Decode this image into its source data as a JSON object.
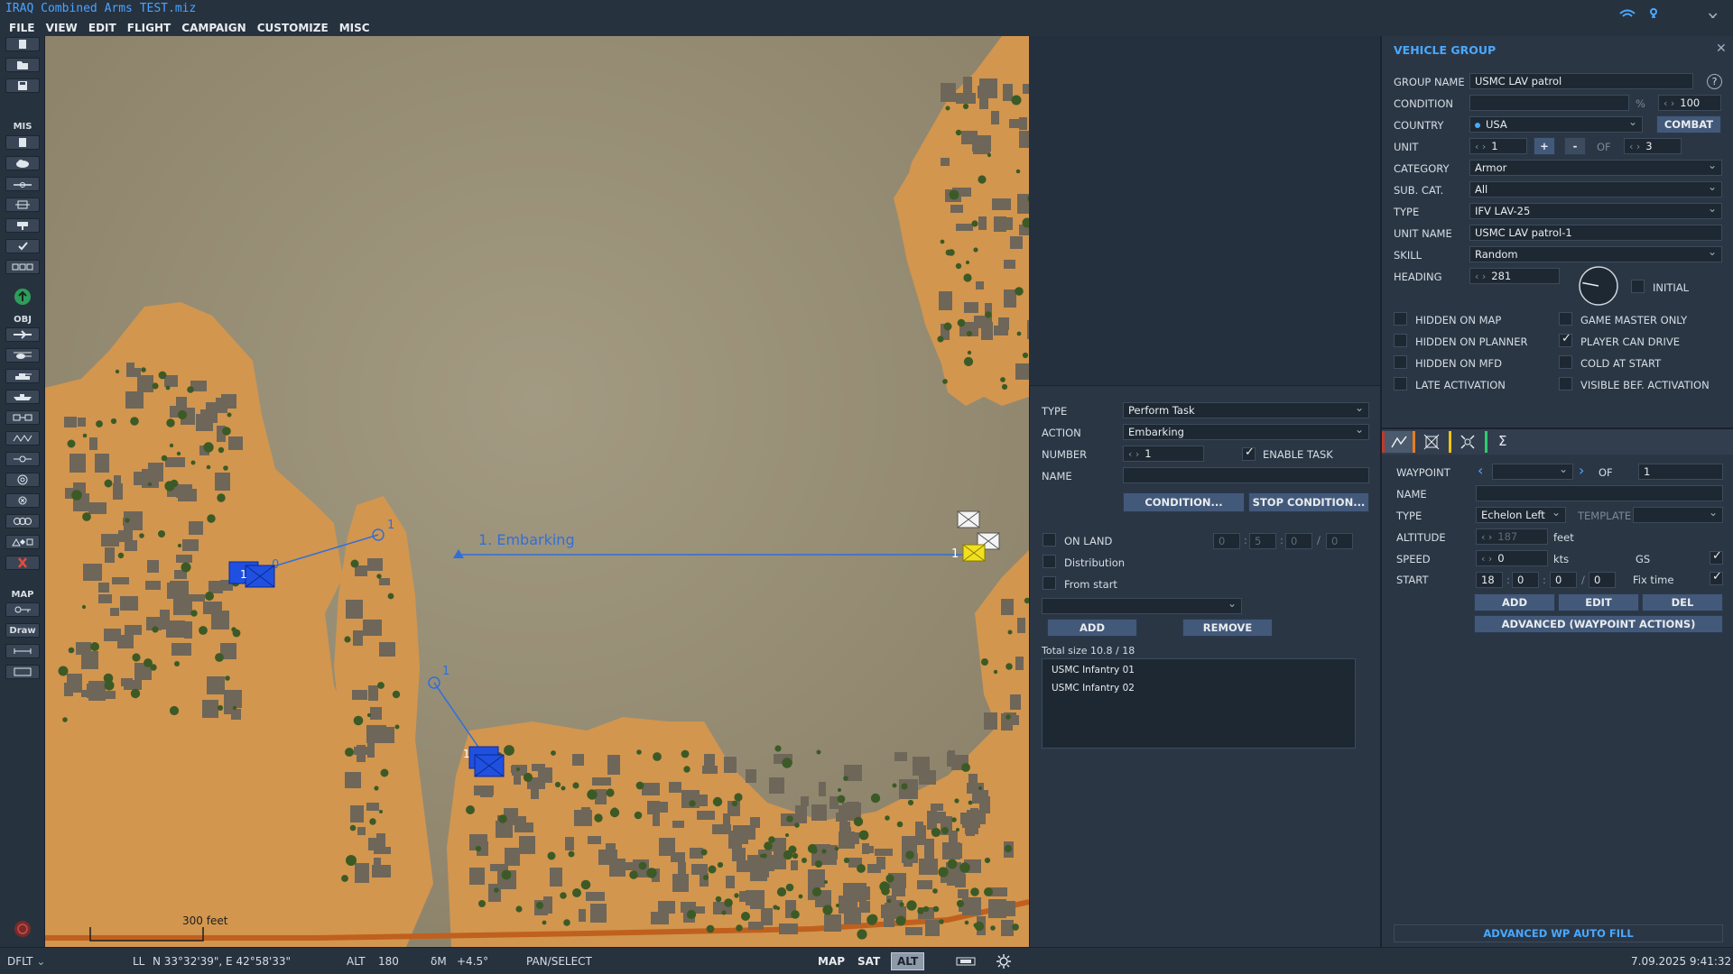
{
  "app": {
    "title": "IRAQ Combined Arms TEST.miz"
  },
  "menu": [
    "FILE",
    "VIEW",
    "EDIT",
    "FLIGHT",
    "CAMPAIGN",
    "CUSTOMIZE",
    "MISC"
  ],
  "left_toolbar": {
    "section_mis": "MIS",
    "section_obj": "OBJ",
    "section_map": "MAP",
    "draw_label": "Draw"
  },
  "map": {
    "route_label": "1. Embarking",
    "group1_num": "1",
    "group1_wp0": "0",
    "group1_wp1": "1",
    "group2_num": "1",
    "group2_wp1": "1",
    "target_num": "1",
    "scale_label": "300 feet"
  },
  "task": {
    "type_label": "TYPE",
    "type_value": "Perform Task",
    "action_label": "ACTION",
    "action_value": "Embarking",
    "number_label": "NUMBER",
    "number_value": "1",
    "enable_task_label": "ENABLE TASK",
    "enable_task_checked": true,
    "name_label": "NAME",
    "name_value": "",
    "condition_btn": "CONDITION...",
    "stop_condition_btn": "STOP CONDITION...",
    "on_land_label": "ON LAND",
    "on_land_time": [
      "0",
      "5",
      "0",
      "0"
    ],
    "distribution_label": "Distribution",
    "from_start_label": "From start",
    "add_btn": "ADD",
    "remove_btn": "REMOVE",
    "total_size": "Total size 10.8 / 18",
    "cargo": [
      "USMC Infantry 01",
      "USMC Infantry 02"
    ]
  },
  "vehicle_group": {
    "title": "VEHICLE GROUP",
    "help": "?",
    "group_name_label": "GROUP NAME",
    "group_name": "USMC LAV patrol",
    "condition_label": "CONDITION",
    "condition_pct": "%",
    "condition_value": "100",
    "country_label": "COUNTRY",
    "country": "USA",
    "combat_btn": "COMBAT",
    "unit_label": "UNIT",
    "unit_value": "1",
    "plus": "+",
    "minus": "-",
    "of_label": "OF",
    "unit_total": "3",
    "category_label": "CATEGORY",
    "category": "Armor",
    "subcat_label": "SUB. CAT.",
    "subcat": "All",
    "type_label": "TYPE",
    "type": "IFV LAV-25",
    "unit_name_label": "UNIT NAME",
    "unit_name": "USMC LAV patrol-1",
    "skill_label": "SKILL",
    "skill": "Random",
    "heading_label": "HEADING",
    "heading": "281",
    "heading_deg": 281,
    "initial_label": "INITIAL",
    "checks": [
      {
        "label": "HIDDEN ON MAP",
        "checked": false
      },
      {
        "label": "GAME MASTER ONLY",
        "checked": false
      },
      {
        "label": "HIDDEN ON PLANNER",
        "checked": false
      },
      {
        "label": "PLAYER CAN DRIVE",
        "checked": true
      },
      {
        "label": "HIDDEN ON MFD",
        "checked": false
      },
      {
        "label": "COLD AT START",
        "checked": false
      },
      {
        "label": "LATE ACTIVATION",
        "checked": false
      },
      {
        "label": "VISIBLE BEF. ACTIVATION",
        "checked": false
      }
    ],
    "tab_colors": [
      "#c0392b",
      "#e67e22",
      "#f1c40f",
      "#2ecc71"
    ],
    "waypoint_label": "WAYPOINT",
    "waypoint_value": "",
    "wp_of_label": "OF",
    "wp_total": "1",
    "wp_name_label": "NAME",
    "wp_name": "",
    "wp_type_label": "TYPE",
    "wp_type": "Echelon Left",
    "template_label": "TEMPLATE",
    "template": "",
    "altitude_label": "ALTITUDE",
    "altitude": "187",
    "altitude_unit": "feet",
    "speed_label": "SPEED",
    "speed": "0",
    "speed_unit": "kts",
    "gs_label": "GS",
    "start_label": "START",
    "start_h": "18",
    "start_m": "0",
    "start_s": "0",
    "start_f": "0",
    "fix_time_label": "Fix time",
    "add_btn": "ADD",
    "edit_btn": "EDIT",
    "del_btn": "DEL",
    "advanced_btn": "ADVANCED (WAYPOINT ACTIONS)",
    "autofill_btn": "ADVANCED WP AUTO FILL"
  },
  "status": {
    "profile": "DFLT",
    "ll_label": "LL",
    "coords": "N 33°32'39\", E 42°58'33\"",
    "alt_label": "ALT",
    "alt_value": "180",
    "dm_label": "δM",
    "dm_value": "+4.5°",
    "mode": "PAN/SELECT",
    "btn_map": "MAP",
    "btn_sat": "SAT",
    "btn_alt": "ALT",
    "datetime": "7.09.2025 9:41:32"
  }
}
